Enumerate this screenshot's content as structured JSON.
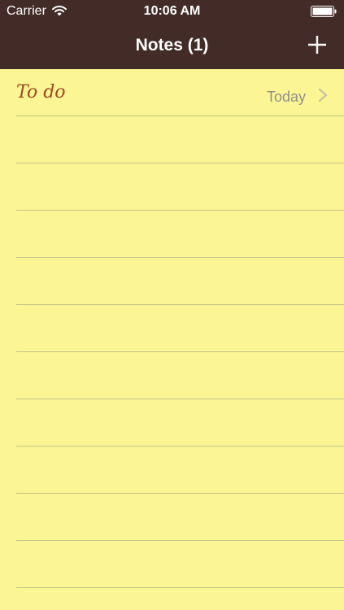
{
  "status_bar": {
    "carrier": "Carrier",
    "time": "10:06 AM",
    "icons": [
      "wifi-icon",
      "battery-icon"
    ]
  },
  "nav": {
    "title": "Notes (1)",
    "add_icon": "plus-icon"
  },
  "notes": [
    {
      "title": "To do",
      "date": "Today",
      "icon": "chevron-right-icon"
    }
  ],
  "colors": {
    "bar_background": "#432c28",
    "paper": "#fbf693",
    "rule_line": "#c6c28a",
    "note_title": "#9b4a23",
    "date_text": "#8f8f8f",
    "chevron": "#c8c3a1"
  }
}
